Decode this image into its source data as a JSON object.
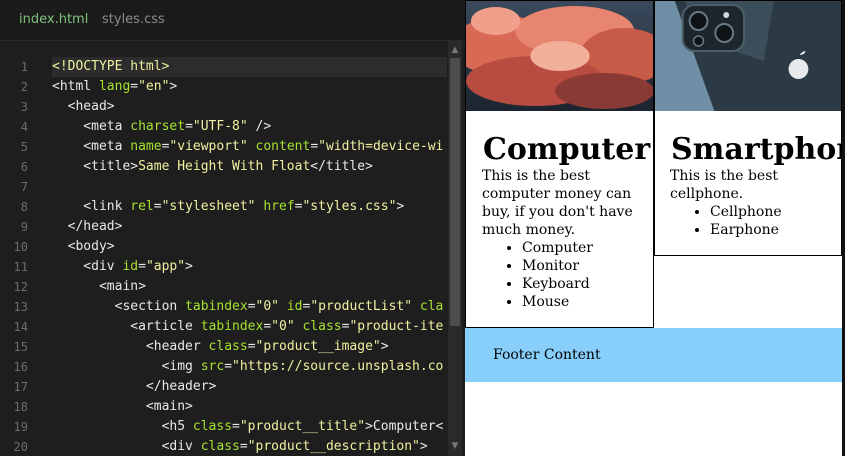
{
  "editor": {
    "tabs": [
      {
        "label": "index.html",
        "active": true
      },
      {
        "label": "styles.css",
        "active": false
      }
    ],
    "line_numbers": [
      "1",
      "2",
      "3",
      "4",
      "5",
      "6",
      "7",
      "8",
      "9",
      "10",
      "11",
      "12",
      "13",
      "14",
      "15",
      "16",
      "17",
      "18",
      "19",
      "20"
    ],
    "lines": [
      [
        {
          "t": "doc",
          "v": "<!DOCTYPE html>"
        }
      ],
      [
        {
          "t": "tag",
          "v": "<html "
        },
        {
          "t": "attr",
          "v": "lang"
        },
        {
          "t": "tag",
          "v": "="
        },
        {
          "t": "str",
          "v": "\"en\""
        },
        {
          "t": "tag",
          "v": ">"
        }
      ],
      [
        {
          "t": "tag",
          "v": "  <head>"
        }
      ],
      [
        {
          "t": "tag",
          "v": "    <meta "
        },
        {
          "t": "attr",
          "v": "charset"
        },
        {
          "t": "tag",
          "v": "="
        },
        {
          "t": "str",
          "v": "\"UTF-8\""
        },
        {
          "t": "tag",
          "v": " />"
        }
      ],
      [
        {
          "t": "tag",
          "v": "    <meta "
        },
        {
          "t": "attr",
          "v": "name"
        },
        {
          "t": "tag",
          "v": "="
        },
        {
          "t": "str",
          "v": "\"viewport\""
        },
        {
          "t": "tag",
          "v": " "
        },
        {
          "t": "attr",
          "v": "content"
        },
        {
          "t": "tag",
          "v": "="
        },
        {
          "t": "str",
          "v": "\"width=device-wi"
        }
      ],
      [
        {
          "t": "tag",
          "v": "    <title>"
        },
        {
          "t": "str",
          "v": "Same Height With Float"
        },
        {
          "t": "tag",
          "v": "</title>"
        }
      ],
      [
        {
          "t": "tag",
          "v": ""
        }
      ],
      [
        {
          "t": "tag",
          "v": "    <link "
        },
        {
          "t": "attr",
          "v": "rel"
        },
        {
          "t": "tag",
          "v": "="
        },
        {
          "t": "str",
          "v": "\"stylesheet\""
        },
        {
          "t": "tag",
          "v": " "
        },
        {
          "t": "attr",
          "v": "href"
        },
        {
          "t": "tag",
          "v": "="
        },
        {
          "t": "str",
          "v": "\"styles.css\""
        },
        {
          "t": "tag",
          "v": ">"
        }
      ],
      [
        {
          "t": "tag",
          "v": "  </head>"
        }
      ],
      [
        {
          "t": "tag",
          "v": "  <body>"
        }
      ],
      [
        {
          "t": "tag",
          "v": "    <div "
        },
        {
          "t": "attr",
          "v": "id"
        },
        {
          "t": "tag",
          "v": "="
        },
        {
          "t": "str",
          "v": "\"app\""
        },
        {
          "t": "tag",
          "v": ">"
        }
      ],
      [
        {
          "t": "tag",
          "v": "      <main>"
        }
      ],
      [
        {
          "t": "tag",
          "v": "        <section "
        },
        {
          "t": "attr",
          "v": "tabindex"
        },
        {
          "t": "tag",
          "v": "="
        },
        {
          "t": "str",
          "v": "\"0\""
        },
        {
          "t": "tag",
          "v": " "
        },
        {
          "t": "attr",
          "v": "id"
        },
        {
          "t": "tag",
          "v": "="
        },
        {
          "t": "str",
          "v": "\"productList\""
        },
        {
          "t": "tag",
          "v": " "
        },
        {
          "t": "attr",
          "v": "cla"
        }
      ],
      [
        {
          "t": "tag",
          "v": "          <article "
        },
        {
          "t": "attr",
          "v": "tabindex"
        },
        {
          "t": "tag",
          "v": "="
        },
        {
          "t": "str",
          "v": "\"0\""
        },
        {
          "t": "tag",
          "v": " "
        },
        {
          "t": "attr",
          "v": "class"
        },
        {
          "t": "tag",
          "v": "="
        },
        {
          "t": "str",
          "v": "\"product-ite"
        }
      ],
      [
        {
          "t": "tag",
          "v": "            <header "
        },
        {
          "t": "attr",
          "v": "class"
        },
        {
          "t": "tag",
          "v": "="
        },
        {
          "t": "str",
          "v": "\"product__image\""
        },
        {
          "t": "tag",
          "v": ">"
        }
      ],
      [
        {
          "t": "tag",
          "v": "              <img "
        },
        {
          "t": "attr",
          "v": "src"
        },
        {
          "t": "tag",
          "v": "="
        },
        {
          "t": "str",
          "v": "\"https://source.unsplash.co"
        }
      ],
      [
        {
          "t": "tag",
          "v": "            </header>"
        }
      ],
      [
        {
          "t": "tag",
          "v": "            <main>"
        }
      ],
      [
        {
          "t": "tag",
          "v": "              <h5 "
        },
        {
          "t": "attr",
          "v": "class"
        },
        {
          "t": "tag",
          "v": "="
        },
        {
          "t": "str",
          "v": "\"product__title\""
        },
        {
          "t": "tag",
          "v": ">Computer<"
        }
      ],
      [
        {
          "t": "tag",
          "v": "              <div "
        },
        {
          "t": "attr",
          "v": "class"
        },
        {
          "t": "tag",
          "v": "="
        },
        {
          "t": "str",
          "v": "\"product__description\""
        },
        {
          "t": "tag",
          "v": ">"
        }
      ]
    ]
  },
  "preview": {
    "cards": [
      {
        "title": "Computer",
        "description": "This is the best computer money can buy, if you don't have much money.",
        "items": [
          "Computer",
          "Monitor",
          "Keyboard",
          "Mouse"
        ]
      },
      {
        "title": "Smartphone",
        "description": "This is the best cellphone.",
        "items": [
          "Cellphone",
          "Earphone"
        ]
      }
    ],
    "footer": "Footer Content"
  },
  "colors": {
    "editor_bg": "#1e1e1e",
    "active_tab": "#7ec27a",
    "attribute": "#a6e22e",
    "string": "#f0f0a0",
    "footer_bg": "#87cefa"
  }
}
